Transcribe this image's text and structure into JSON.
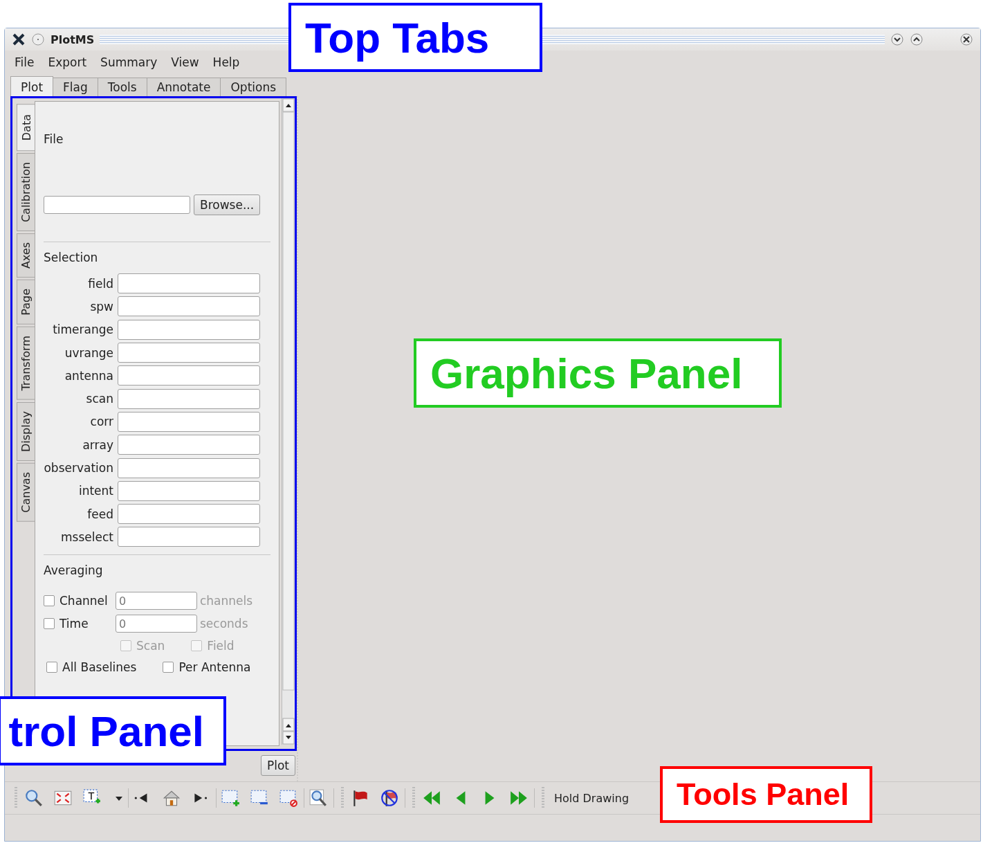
{
  "window": {
    "title": "PlotMS"
  },
  "menu": [
    {
      "label": "File"
    },
    {
      "label": "Export"
    },
    {
      "label": "Summary"
    },
    {
      "label": "View"
    },
    {
      "label": "Help"
    }
  ],
  "tabs": [
    {
      "label": "Plot",
      "selected": true
    },
    {
      "label": "Flag",
      "selected": false
    },
    {
      "label": "Tools",
      "selected": false
    },
    {
      "label": "Annotate",
      "selected": false
    },
    {
      "label": "Options",
      "selected": false
    }
  ],
  "side_tabs": [
    {
      "label": "Data",
      "selected": true
    },
    {
      "label": "Calibration",
      "selected": false
    },
    {
      "label": "Axes",
      "selected": false
    },
    {
      "label": "Page",
      "selected": false
    },
    {
      "label": "Transform",
      "selected": false
    },
    {
      "label": "Display",
      "selected": false
    },
    {
      "label": "Canvas",
      "selected": false
    }
  ],
  "data_page": {
    "file_label": "File",
    "browse_button": "Browse...",
    "selection_heading": "Selection",
    "selection_fields": [
      {
        "label": "field"
      },
      {
        "label": "spw"
      },
      {
        "label": "timerange"
      },
      {
        "label": "uvrange"
      },
      {
        "label": "antenna"
      },
      {
        "label": "scan"
      },
      {
        "label": "corr"
      },
      {
        "label": "array"
      },
      {
        "label": "observation"
      },
      {
        "label": "intent"
      },
      {
        "label": "feed"
      },
      {
        "label": "msselect"
      }
    ],
    "averaging_heading": "Averaging",
    "averaging": [
      {
        "kind": "value",
        "label": "Channel",
        "checked": false,
        "value": "0",
        "unit": "channels",
        "disabled": true
      },
      {
        "kind": "value",
        "label": "Time",
        "checked": false,
        "value": "0",
        "unit": "seconds",
        "disabled": true
      },
      {
        "kind": "sub_pair",
        "items": [
          {
            "label": "Scan",
            "checked": false,
            "disabled": true
          },
          {
            "label": "Field",
            "checked": false,
            "disabled": true
          }
        ]
      },
      {
        "kind": "pair",
        "items": [
          {
            "label": "All Baselines",
            "checked": false,
            "disabled": false
          },
          {
            "label": "Per Antenna",
            "checked": false,
            "disabled": false
          }
        ]
      }
    ]
  },
  "bottom": {
    "plot_button": "Plot"
  },
  "toolbar": {
    "hold_drawing": "Hold Drawing"
  },
  "callouts": [
    {
      "text": "Top Tabs",
      "color": "#0000ff"
    },
    {
      "text": "Graphics Panel",
      "color": "#22cc22"
    },
    {
      "text": "trol Panel",
      "color": "#0000ff"
    },
    {
      "text": "Tools Panel",
      "color": "#ff0000"
    }
  ]
}
